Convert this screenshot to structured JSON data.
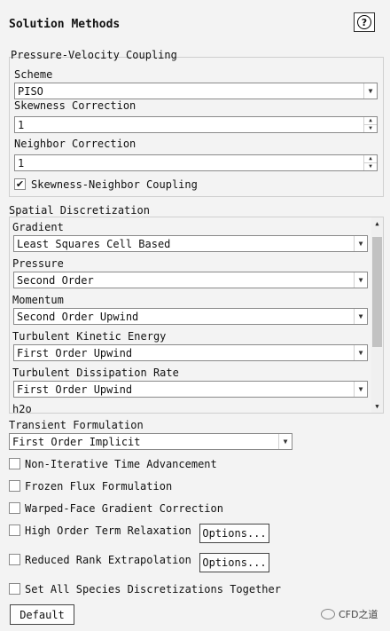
{
  "panel": {
    "title": "Solution Methods",
    "help_icon": "?"
  },
  "pv_coupling": {
    "group_label": "Pressure-Velocity Coupling",
    "scheme_label": "Scheme",
    "scheme_value": "PISO",
    "skewness_label": "Skewness Correction",
    "skewness_value": "1",
    "neighbor_label": "Neighbor Correction",
    "neighbor_value": "1",
    "coupling_checkbox": {
      "label": "Skewness-Neighbor Coupling",
      "checked": true,
      "mark": "✔"
    }
  },
  "spatial": {
    "group_label": "Spatial Discretization",
    "items": [
      {
        "label": "Gradient",
        "value": "Least Squares Cell Based"
      },
      {
        "label": "Pressure",
        "value": "Second Order"
      },
      {
        "label": "Momentum",
        "value": "Second Order Upwind"
      },
      {
        "label": "Turbulent Kinetic Energy",
        "value": "First Order Upwind"
      },
      {
        "label": "Turbulent Dissipation Rate",
        "value": "First Order Upwind"
      },
      {
        "label": "h2o",
        "value": ""
      }
    ]
  },
  "transient": {
    "label": "Transient Formulation",
    "value": "First Order Implicit"
  },
  "options": [
    {
      "label": "Non-Iterative Time Advancement",
      "checked": false
    },
    {
      "label": "Frozen Flux Formulation",
      "checked": false
    },
    {
      "label": "Warped-Face Gradient Correction",
      "checked": false
    },
    {
      "label": "High Order Term Relaxation",
      "checked": false,
      "button": "Options..."
    },
    {
      "label": "Reduced Rank Extrapolation",
      "checked": false,
      "button": "Options..."
    },
    {
      "label": "Set All Species Discretizations Together",
      "checked": false
    }
  ],
  "default_button": "Default",
  "watermark": "CFD之道",
  "icons": {
    "dropdown": "▼",
    "spin_up": "▲",
    "spin_down": "▼",
    "scroll_up": "▲",
    "scroll_down": "▼"
  }
}
